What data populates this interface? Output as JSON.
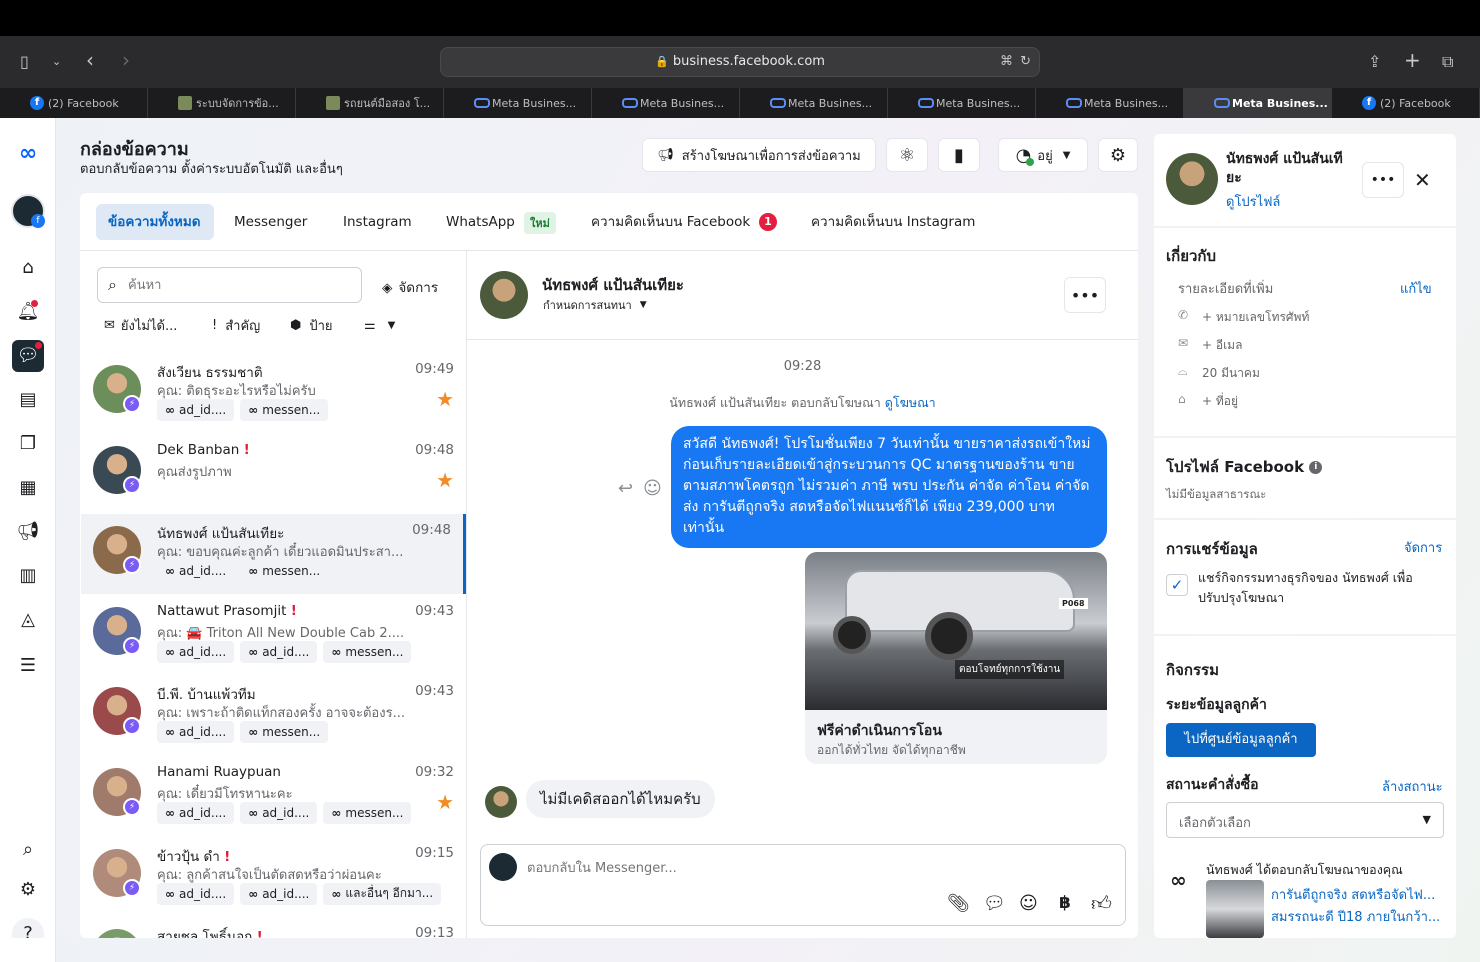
{
  "browser": {
    "url": "business.facebook.com",
    "tabs": [
      {
        "label": "(2) Facebook",
        "icon": "facebook-icon"
      },
      {
        "label": "ระบบจัดการข้อ...",
        "icon": "doc-icon"
      },
      {
        "label": "รถยนต์มือสอง โ...",
        "icon": "doc-icon"
      },
      {
        "label": "Meta Busines...",
        "icon": "meta-icon"
      },
      {
        "label": "Meta Busines...",
        "icon": "meta-icon"
      },
      {
        "label": "Meta Busines...",
        "icon": "meta-icon"
      },
      {
        "label": "Meta Busines...",
        "icon": "meta-icon"
      },
      {
        "label": "Meta Busines...",
        "icon": "meta-icon"
      },
      {
        "label": "Meta Busines...",
        "icon": "meta-icon",
        "active": true
      },
      {
        "label": "(2) Facebook",
        "icon": "facebook-icon"
      }
    ]
  },
  "header": {
    "title": "กล่องข้อความ",
    "subtitle": "ตอบกลับข้อความ ตั้งค่าระบบอัตโนมัติ และอื่นๆ",
    "create_ad_label": "สร้างโฆษณาเพื่อการส่งข้อความ",
    "status_label": "อยู่"
  },
  "filter_tabs": [
    {
      "label": "ข้อความทั้งหมด"
    },
    {
      "label": "Messenger"
    },
    {
      "label": "Instagram"
    },
    {
      "label": "WhatsApp"
    },
    {
      "label": "ความคิดเห็นบน Facebook"
    },
    {
      "label": "ความคิดเห็นบน Instagram"
    }
  ],
  "whatsapp_badge": "ใหม่",
  "fb_comments_count": "1",
  "search": {
    "placeholder": "ค้นหา",
    "manage_label": "จัดการ"
  },
  "filters": {
    "unread": "ยังไม่ได้...",
    "important": "สำคัญ",
    "label": "ป้าย"
  },
  "conversations": [
    {
      "name": "สังเวียน ธรรมชาติ",
      "time": "09:49",
      "preview": "คุณ: ติดธุระอะไรหรือไม่ครับ",
      "chips": [
        "ad_id....",
        "messen..."
      ],
      "starred": true,
      "flag": false
    },
    {
      "name": "Dek Banban",
      "time": "09:48",
      "preview": "คุณส่งรูปภาพ",
      "chips": [],
      "starred": true,
      "flag": true
    },
    {
      "name": "นัทธพงศ์ แป้นสันเทียะ",
      "time": "09:48",
      "preview": "คุณ: ขอบคุณค่ะลูกค้า เดี๋ยวแอดมินประสา...",
      "chips": [
        "ad_id....",
        "messen..."
      ],
      "starred": false,
      "flag": false,
      "selected": true
    },
    {
      "name": "Nattawut Prasomjit",
      "time": "09:43",
      "preview": "คุณ: 🚘 Triton All New Double Cab 2....",
      "chips": [
        "ad_id....",
        "ad_id....",
        "messen..."
      ],
      "starred": false,
      "flag": true
    },
    {
      "name": "บี.พี. บ้านแพ้วทีม",
      "time": "09:43",
      "preview": "คุณ: เพราะถ้าติดแท็กสองครั้ง อาจจะต้องร...",
      "chips": [
        "ad_id....",
        "messen..."
      ],
      "starred": false,
      "flag": false
    },
    {
      "name": "Hanami Ruaypuan",
      "time": "09:32",
      "preview": "คุณ: เดี๋ยวมีโทรหานะคะ",
      "chips": [
        "ad_id....",
        "ad_id....",
        "messen..."
      ],
      "starred": true,
      "flag": false
    },
    {
      "name": "ข้าวปุ้น ดำ",
      "time": "09:15",
      "preview": "คุณ: ลูกค้าสนใจเป็นตัดสดหรือว่าผ่อนคะ",
      "chips": [
        "ad_id....",
        "ad_id....",
        "และอื่นๆ อีกมา..."
      ],
      "starred": false,
      "flag": true
    },
    {
      "name": "สายชล โพธิ์นอก",
      "time": "09:13",
      "preview": "",
      "chips": [],
      "starred": false,
      "flag": true
    }
  ],
  "chat": {
    "name": "นัทธพงศ์ แป้นสันเทียะ",
    "assign_label": "กำหนดการสนทนา",
    "timestamp": "09:28",
    "ad_reply_note": "นัทธพงศ์ แป้นสันเทียะ ตอบกลับโฆษณา",
    "view_ad_link": "ดูโฆษณา",
    "outgoing_message": "สวัสดี นัทธพงศ์! โปรโมชั่นเพียง 7 วันเท่านั้น ขายราคาส่งรถเข้าใหม่ ก่อนเก็บรายละเอียดเข้าสู่กระบวนการ QC มาตรฐานของร้าน ขายตามสภาพโคตรถูก ไม่รวมค่า ภาษี พรบ ประกัน ค่าจัด ค่าโอน ค่าจัดส่ง การันตีถูกจริง สดหรือจัดไฟแนนซ์ก็ได้  เพียง 239,000 บาทเท่านั้น",
    "card_title": "ฟรีค่าดำเนินการโอน",
    "card_subtitle": "ออกได้ทั่วไทย จัดได้ทุกอาชีพ",
    "card_image_caption": "ตอบโจทย์ทุกการใช้งาน",
    "card_plate": "P068",
    "incoming_message": "ไม่มีเคดิสออกได้ไหมครับ",
    "composer_placeholder": "ตอบกลับใน Messenger..."
  },
  "profile": {
    "name": "นัทธพงศ์ แป้นสันเทียะ",
    "view_profile": "ดูโปรไฟล์",
    "about_title": "เกี่ยวกับ",
    "details_label": "รายละเอียดที่เพิ่ม",
    "edit_label": "แก้ไข",
    "phone": "+ หมายเลขโทรศัพท์",
    "email": "+ อีเมล",
    "birthday": "20 มีนาคม",
    "address": "+ ที่อยู่",
    "fb_profile_title": "โปรไฟล์ Facebook",
    "no_public_info": "ไม่มีข้อมูลสาธารณะ",
    "sharing_title": "การแชร์ข้อมูล",
    "manage_label": "จัดการ",
    "sharing_text": "แชร์กิจกรรมทางธุรกิจของ นัทธพงศ์ เพื่อปรับปรุงโฆษณา",
    "activity_title": "กิจกรรม",
    "customer_info_title": "ระยะข้อมูลลูกค้า",
    "customer_center_button": "ไปที่ศูนย์ข้อมูลลูกค้า",
    "order_status_title": "สถานะคำสั่งซื้อ",
    "clear_status": "ล้างสถานะ",
    "select_placeholder": "เลือกตัวเลือก",
    "activity_note": "นัทธพงศ์ ได้ตอบกลับโฆษณาของคุณ",
    "activity_ad_line1": "การันตีถูกจริง สดหรือจัดไฟ...",
    "activity_ad_line2": "สมรรถนะดี ปี18 ภายในกว้า..."
  },
  "colors": {
    "accent": "#0866ff",
    "link": "#0a66c2",
    "bubble": "#1877f2",
    "star": "#f28c28",
    "alert": "#e41e3f",
    "selected_tab_bg": "#dfe9f5"
  }
}
